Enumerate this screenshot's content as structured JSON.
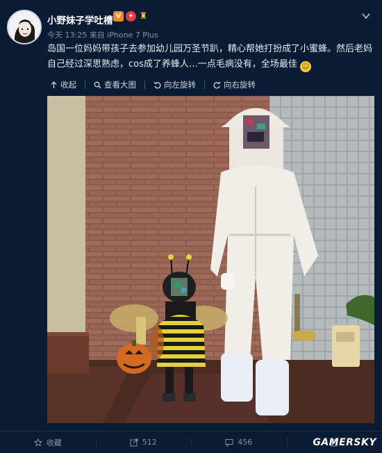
{
  "user": {
    "name": "小野妹子学吐槽",
    "meta": "今天 13:25 来自 iPhone 7 Plus"
  },
  "post": {
    "text": "岛国一位妈妈带孩子去参加幼儿园万圣节趴，精心帮她打扮成了小蜜蜂。然后老妈自己经过深思熟虑，cos成了养蜂人…一点毛病没有，全场最佳"
  },
  "toolbar": {
    "collapse": "收起",
    "view_large": "查看大图",
    "rotate_left": "向左旋转",
    "rotate_right": "向右旋转"
  },
  "footer": {
    "favorite": "收藏",
    "repost_count": "512",
    "comment_count": "456"
  },
  "watermark": "GAMERSKY",
  "colors": {
    "background": "#0a1c33",
    "accent_v": "#f08a24"
  }
}
